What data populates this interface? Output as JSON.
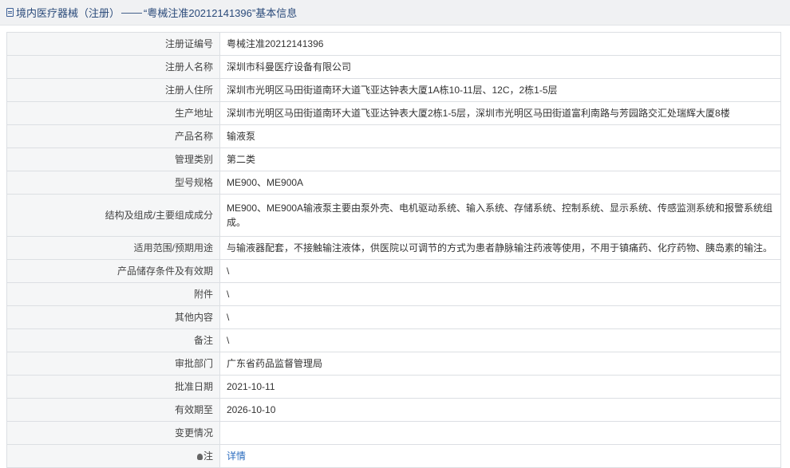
{
  "header": {
    "icon": "document-icon",
    "section": "境内医疗器械（注册）",
    "separator": "——",
    "record_title": "“粤械注准20212141396”基本信息"
  },
  "rows": [
    {
      "label": "注册证编号",
      "value": "粤械注准20212141396"
    },
    {
      "label": "注册人名称",
      "value": "深圳市科曼医疗设备有限公司"
    },
    {
      "label": "注册人住所",
      "value": "深圳市光明区马田街道南环大道飞亚达钟表大厦1A栋10-11层、12C，2栋1-5层"
    },
    {
      "label": "生产地址",
      "value": "深圳市光明区马田街道南环大道飞亚达钟表大厦2栋1-5层，深圳市光明区马田街道富利南路与芳园路交汇处瑞辉大厦8楼"
    },
    {
      "label": "产品名称",
      "value": "输液泵"
    },
    {
      "label": "管理类别",
      "value": "第二类"
    },
    {
      "label": "型号规格",
      "value": "ME900、ME900A"
    },
    {
      "label": "结构及组成/主要组成成分",
      "value": "ME900、ME900A输液泵主要由泵外壳、电机驱动系统、输入系统、存储系统、控制系统、显示系统、传感监测系统和报警系统组成。"
    },
    {
      "label": "适用范围/预期用途",
      "value": "与输液器配套，不接触输注液体，供医院以可调节的方式为患者静脉输注药液等使用，不用于镇痛药、化疗药物、胰岛素的输注。"
    },
    {
      "label": "产品储存条件及有效期",
      "value": "\\"
    },
    {
      "label": "附件",
      "value": "\\"
    },
    {
      "label": "其他内容",
      "value": "\\"
    },
    {
      "label": "备注",
      "value": "\\"
    },
    {
      "label": "审批部门",
      "value": "广东省药品监督管理局"
    },
    {
      "label": "批准日期",
      "value": "2021-10-11"
    },
    {
      "label": "有效期至",
      "value": "2026-10-10"
    },
    {
      "label": "变更情况",
      "value": ""
    },
    {
      "label": "注",
      "value": "详情",
      "icon": "lightbulb-icon"
    }
  ],
  "colors": {
    "header_bg": "#f0f1f3",
    "label_bg": "#f5f6f7",
    "link": "#2c6dbf",
    "border": "#dcdfe3"
  }
}
